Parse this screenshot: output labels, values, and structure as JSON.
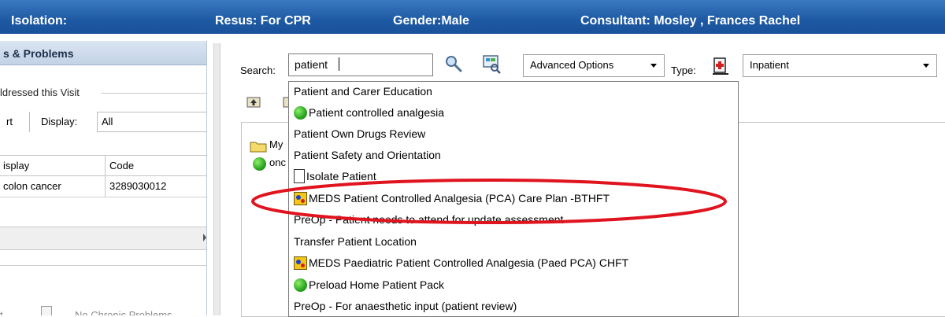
{
  "banner": {
    "isolation": "Isolation:",
    "resus": "Resus: For CPR",
    "gender": "Gender:Male",
    "consultant": "Consultant: Mosley , Frances Rachel"
  },
  "left_panel": {
    "header": "s & Problems",
    "group_label": "ldressed this Visit",
    "toolbar_left": "rt",
    "display_label": "Display:",
    "display_value": "All",
    "table": {
      "columns": [
        "isplay",
        "Code"
      ],
      "rows": [
        [
          "colon cancer",
          "3289030012"
        ]
      ]
    },
    "chronic_left": "t",
    "chronic_label": "No Chronic Problems"
  },
  "search": {
    "label": "Search:",
    "value": "patient"
  },
  "advanced": {
    "value": "Advanced Options"
  },
  "type": {
    "label": "Type:",
    "value": "Inpatient"
  },
  "tree": {
    "my_label": "My",
    "onc_label": "onc"
  },
  "dropdown": {
    "items": [
      {
        "label": "Patient and Carer Education",
        "icon": "none"
      },
      {
        "label": "Patient controlled analgesia",
        "icon": "green-circle-icon"
      },
      {
        "label": "Patient Own Drugs Review",
        "icon": "none"
      },
      {
        "label": "Patient Safety and Orientation",
        "icon": "none"
      },
      {
        "label": "Isolate Patient",
        "icon": "document-icon"
      },
      {
        "label": "MEDS Patient Controlled Analgesia (PCA) Care Plan -BTHFT",
        "icon": "meds-icon"
      },
      {
        "label": "PreOp - Patient needs to attend for update assessment",
        "icon": "none"
      },
      {
        "label": "Transfer Patient Location",
        "icon": "none"
      },
      {
        "label": "MEDS Paediatric Patient Controlled Analgesia (Paed PCA) CHFT",
        "icon": "meds-icon"
      },
      {
        "label": "Preload Home Patient Pack",
        "icon": "green-circle-icon"
      },
      {
        "label": "PreOp - For anaesthetic input (patient review)",
        "icon": "none"
      }
    ]
  },
  "colors": {
    "banner": "#1d5aa3",
    "highlight_ellipse": "#e0141e"
  }
}
